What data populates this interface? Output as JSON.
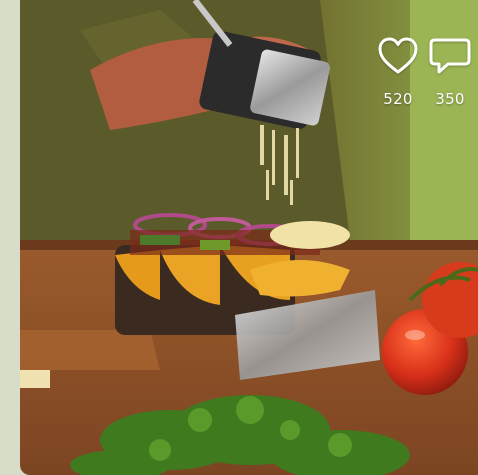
{
  "reactions": {
    "like_count": "520",
    "comment_count": "350"
  },
  "icons": {
    "like": "heart-icon",
    "comment": "speech-bubble-icon"
  },
  "colors": {
    "icon": "#ffffff",
    "side_panel": "#d7ddc8"
  }
}
